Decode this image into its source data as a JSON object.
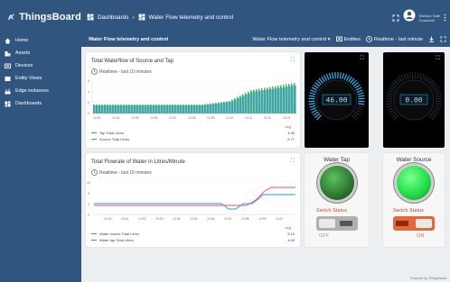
{
  "app": {
    "name": "ThingsBoard"
  },
  "sidebar": {
    "items": [
      {
        "label": "Home",
        "icon": "home-icon"
      },
      {
        "label": "Assets",
        "icon": "domain-icon"
      },
      {
        "label": "Devices",
        "icon": "devices-icon"
      },
      {
        "label": "Entity Views",
        "icon": "view-quilt-icon"
      },
      {
        "label": "Edge instances",
        "icon": "router-icon"
      },
      {
        "label": "Dashboards",
        "icon": "dashboard-icon"
      }
    ]
  },
  "topbar": {
    "breadcrumb_1": "Dashboards",
    "separator": "›",
    "breadcrumb_2": "Water Flow telemetry and control",
    "user_name": "Division Kate",
    "user_role": "Customer"
  },
  "subbar": {
    "title": "Water Flow telemetry and control",
    "dashboard_select": "Water Flow telemetry and control ▾",
    "entities_label": "Entities",
    "realtime_label": "Realtime - last minute"
  },
  "chart1": {
    "title": "Total Waterflow of Source and Tap",
    "subtitle": "Realtime - last 10 minutes",
    "y_ticks": [
      "6",
      "4",
      "2",
      "0"
    ],
    "x_ticks": [
      "10:53",
      "10:54",
      "10:55",
      "10:56",
      "10:57",
      "10:58",
      "10:59",
      "11:00",
      "11:01",
      "11:02",
      "11:03"
    ],
    "legend_header": "avg",
    "series": [
      {
        "name": "Tap Total Litres",
        "value": "4.95",
        "color": "#2196f3"
      },
      {
        "name": "Source Total Litres",
        "value": "5.77",
        "color": "#4caf50"
      }
    ]
  },
  "chart2": {
    "title": "Total Flowrate of Water in Litres/Minute",
    "subtitle": "Realtime - last 15 minutes",
    "y_ticks": [
      "10",
      "5",
      "0",
      "-5"
    ],
    "x_ticks": [
      "10:50",
      "10:51",
      "10:52",
      "10:53",
      "10:54",
      "10:55",
      "10:56",
      "10:57",
      "10:58",
      "10:59",
      "11:00"
    ],
    "legend_header": "avg",
    "series": [
      {
        "name": "Water source Total Litres",
        "value": "5.19",
        "color": "#2196f3"
      },
      {
        "name": "Water tap Total Litres",
        "value": "4.83",
        "color": "#ef5350"
      }
    ]
  },
  "gauge1": {
    "value": "46.00",
    "accent": "#29b6f6"
  },
  "gauge2": {
    "value": "0.00",
    "accent": "#29b6f6"
  },
  "water_tap": {
    "title": "Water Tap",
    "switch_label": "Switch Status",
    "state": "OFF",
    "led_color": "#2e7d32"
  },
  "water_source": {
    "title": "Water Source",
    "switch_label": "Switch Status",
    "state": "ON",
    "led_color": "#22e04a"
  },
  "footer": {
    "text": "Powered by Thingsboard"
  }
}
